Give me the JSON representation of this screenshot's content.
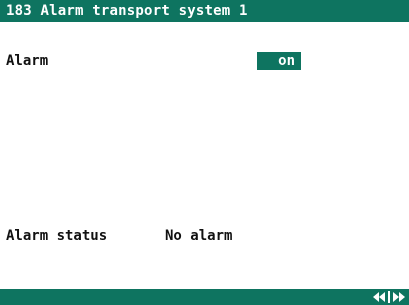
{
  "header": {
    "title": "183 Alarm transport system 1"
  },
  "alarm": {
    "label": "Alarm",
    "value": "on"
  },
  "status": {
    "label": "Alarm status",
    "value": "No alarm"
  },
  "footer": {
    "nav_icon": "left-right-nav-arrows-icon"
  },
  "colors": {
    "accent": "#0e7460",
    "background": "#ffffff",
    "text": "#111111"
  }
}
